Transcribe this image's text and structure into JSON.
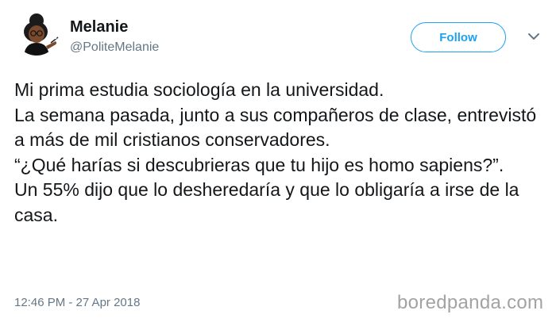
{
  "user": {
    "display_name": "Melanie",
    "handle": "@PoliteMelanie"
  },
  "follow_label": "Follow",
  "tweet_lines": [
    "Mi prima estudia sociología en la universidad.",
    "La semana pasada, junto a sus compañeros de clase, entrevistó a más de mil cristianos conservadores.",
    "“¿Qué harías si descubrieras que tu hijo es homo sapiens?”.",
    "Un 55% dijo que lo desheredaría y que lo obligaría a irse de la casa."
  ],
  "timestamp": "12:46 PM - 27 Apr 2018",
  "watermark": "boredpanda.com",
  "colors": {
    "accent": "#1da1f2",
    "text": "#14171a",
    "muted": "#657786"
  },
  "icons": {
    "avatar": "avatar",
    "menu": "chevron-down-icon"
  }
}
